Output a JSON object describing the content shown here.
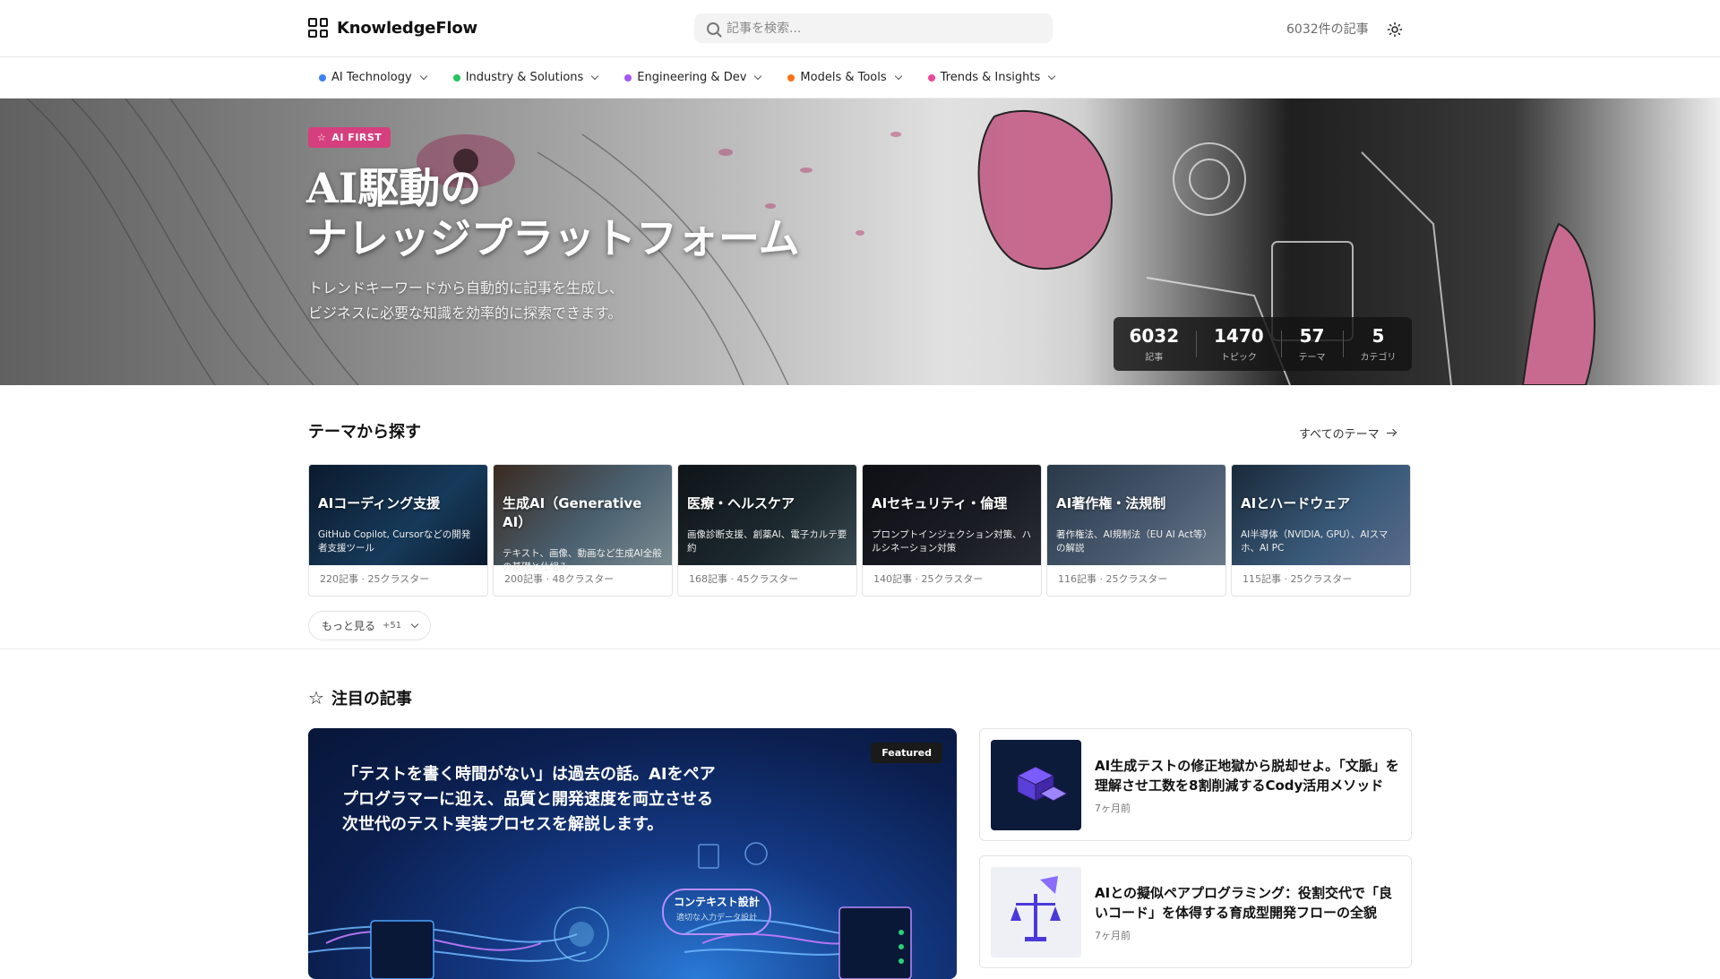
{
  "header": {
    "logo_text": "KnowledgeFlow",
    "search_placeholder": "記事を検索...",
    "article_count": "6032件の記事"
  },
  "categories": [
    {
      "label": "AI Technology",
      "color": "#3b82f6"
    },
    {
      "label": "Industry & Solutions",
      "color": "#22c55e"
    },
    {
      "label": "Engineering & Dev",
      "color": "#a855f7"
    },
    {
      "label": "Models & Tools",
      "color": "#f97316"
    },
    {
      "label": "Trends & Insights",
      "color": "#ec4899"
    }
  ],
  "hero": {
    "badge": "AI FIRST",
    "title_line1": "AI駆動の",
    "title_line2": "ナレッジプラットフォーム",
    "sub_line1": "トレンドキーワードから自動的に記事を生成し、",
    "sub_line2": "ビジネスに必要な知識を効率的に探索できます。",
    "stats": [
      {
        "num": "6032",
        "label": "記事"
      },
      {
        "num": "1470",
        "label": "トピック"
      },
      {
        "num": "57",
        "label": "テーマ"
      },
      {
        "num": "5",
        "label": "カテゴリ"
      }
    ]
  },
  "themes_section": {
    "title": "テーマから探す",
    "all_link": "すべてのテーマ",
    "more_label": "もっと見る",
    "more_count": "+51",
    "themes": [
      {
        "name": "AIコーディング支援",
        "desc": "GitHub Copilot, Cursorなどの開発者支援ツール",
        "meta": "220記事 · 25クラスター"
      },
      {
        "name": "生成AI（Generative AI）",
        "desc": "テキスト、画像、動画など生成AI全般の基礎と仕組み",
        "meta": "200記事 · 48クラスター"
      },
      {
        "name": "医療・ヘルスケア",
        "desc": "画像診断支援、創薬AI、電子カルテ要約",
        "meta": "168記事 · 45クラスター"
      },
      {
        "name": "AIセキュリティ・倫理",
        "desc": "プロンプトインジェクション対策、ハルシネーション対策",
        "meta": "140記事 · 25クラスター"
      },
      {
        "name": "AI著作権・法規制",
        "desc": "著作権法、AI規制法（EU AI Act等）の解説",
        "meta": "116記事 · 25クラスター"
      },
      {
        "name": "AIとハードウェア",
        "desc": "AI半導体（NVIDIA, GPU）、AIスマホ、AI PC",
        "meta": "115記事 · 25クラスター"
      }
    ]
  },
  "featured_section": {
    "title": "注目の記事",
    "main": {
      "tag": "Featured",
      "text": "「テストを書く時間がない」は過去の話。AIをペアプログラマーに迎え、品質と開発速度を両立させる次世代のテスト実装プロセスを解説します。",
      "art_label": "コンテキスト設計",
      "art_sub": "適切な入力データ設計"
    },
    "side": [
      {
        "title": "AI生成テストの修正地獄から脱却せよ。「文脈」を理解させ工数を8割削減するCody活用メソッド",
        "date": "7ヶ月前"
      },
      {
        "title": "AIとの擬似ペアプログラミング：役割交代で「良いコード」を体得する育成型開発フローの全貌",
        "date": "7ヶ月前"
      }
    ]
  }
}
